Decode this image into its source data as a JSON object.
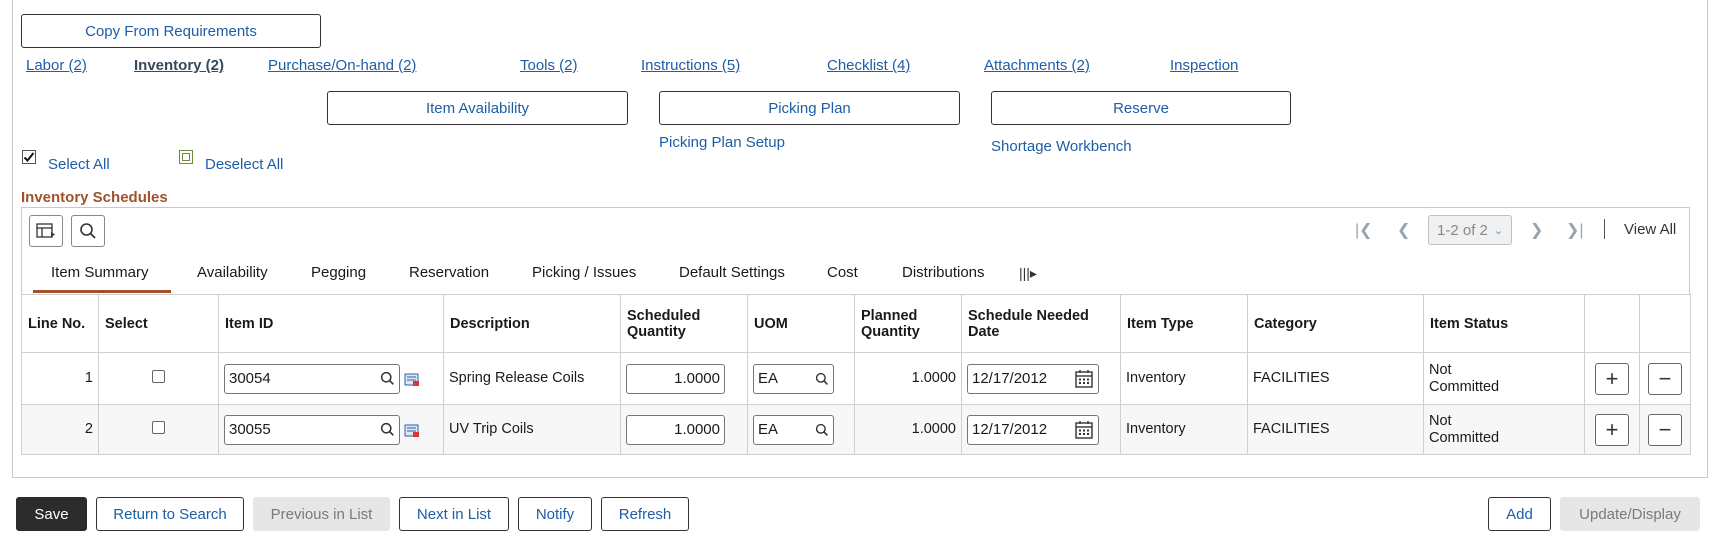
{
  "buttons": {
    "copy_from_requirements": "Copy From Requirements",
    "item_availability": "Item Availability",
    "picking_plan": "Picking Plan",
    "reserve": "Reserve"
  },
  "links": {
    "picking_plan_setup": "Picking Plan Setup",
    "shortage_workbench": "Shortage Workbench"
  },
  "resource_tabs": [
    {
      "label": "Labor (2)",
      "active": false
    },
    {
      "label": "Inventory (2)",
      "active": true
    },
    {
      "label": "Purchase/On-hand (2)",
      "active": false
    },
    {
      "label": "Tools (2)",
      "active": false
    },
    {
      "label": "Instructions (5)",
      "active": false
    },
    {
      "label": "Checklist (4)",
      "active": false
    },
    {
      "label": "Attachments (2)",
      "active": false
    },
    {
      "label": "Inspection",
      "active": false
    }
  ],
  "selection": {
    "select_all": "Select All",
    "deselect_all": "Deselect All"
  },
  "grid": {
    "title": "Inventory Schedules",
    "pager": "1-2 of 2",
    "view_all": "View All",
    "tabs": [
      {
        "label": "Item Summary",
        "active": true
      },
      {
        "label": "Availability",
        "active": false
      },
      {
        "label": "Pegging",
        "active": false
      },
      {
        "label": "Reservation",
        "active": false
      },
      {
        "label": "Picking / Issues",
        "active": false
      },
      {
        "label": "Default Settings",
        "active": false
      },
      {
        "label": "Cost",
        "active": false
      },
      {
        "label": "Distributions",
        "active": false
      }
    ],
    "columns": {
      "line_no": "Line No.",
      "select": "Select",
      "item_id": "Item ID",
      "description": "Description",
      "scheduled_quantity": "Scheduled Quantity",
      "uom": "UOM",
      "planned_quantity": "Planned Quantity",
      "schedule_needed_date": "Schedule Needed Date",
      "item_type": "Item Type",
      "category": "Category",
      "item_status": "Item Status"
    },
    "rows": [
      {
        "line_no": "1",
        "item_id": "30054",
        "description": "Spring Release Coils",
        "scheduled_quantity": "1.0000",
        "uom": "EA",
        "planned_quantity": "1.0000",
        "schedule_needed_date": "12/17/2012",
        "item_type": "Inventory",
        "category": "FACILITIES",
        "item_status": "Not Committed"
      },
      {
        "line_no": "2",
        "item_id": "30055",
        "description": "UV Trip Coils",
        "scheduled_quantity": "1.0000",
        "uom": "EA",
        "planned_quantity": "1.0000",
        "schedule_needed_date": "12/17/2012",
        "item_type": "Inventory",
        "category": "FACILITIES",
        "item_status": "Not Committed"
      }
    ]
  },
  "footer": {
    "save": "Save",
    "return_to_search": "Return to Search",
    "previous_in_list": "Previous in List",
    "next_in_list": "Next in List",
    "notify": "Notify",
    "refresh": "Refresh",
    "add": "Add",
    "update_display": "Update/Display"
  },
  "colors": {
    "link": "#1d5ea6",
    "section_title": "#a0522d",
    "primary_button": "#2b2b2b"
  }
}
